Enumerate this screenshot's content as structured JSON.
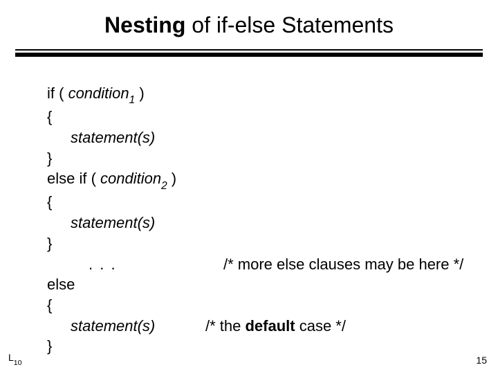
{
  "title": {
    "bold": "Nesting",
    "rest": " of if-else Statements"
  },
  "code": {
    "l1a": "if ( ",
    "l1b": "condition",
    "l1sub": "1",
    "l1c": " )",
    "l2": "{",
    "l3": "statement(s)",
    "l4": "}",
    "l5a": "else if ( ",
    "l5b": "condition",
    "l5sub": "2",
    "l5c": " )",
    "l6": "{",
    "l7": "statement(s)",
    "l8": "}",
    "l9dots": ". . .",
    "l9comment": "/* more else clauses may be here */",
    "l10": "else",
    "l11": "{",
    "l12": "statement(s)",
    "l12comment_a": "/* the ",
    "l12comment_b": "default",
    "l12comment_c": " case */",
    "l13": "}"
  },
  "footer": {
    "left_main": "L",
    "left_sub": "10",
    "right": "15"
  }
}
